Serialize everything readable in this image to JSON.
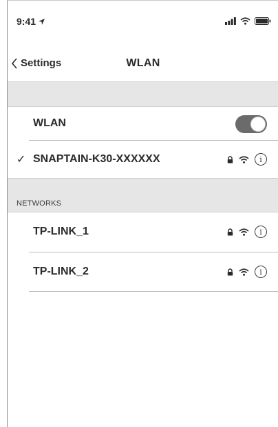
{
  "status_bar": {
    "time": "9:41",
    "icons": [
      "location-arrow-icon",
      "signal-icon",
      "wifi-icon",
      "battery-icon"
    ]
  },
  "nav": {
    "back_label": "Settings",
    "title": "WLAN"
  },
  "wlan_toggle": {
    "label": "WLAN",
    "state": "on"
  },
  "connected_network": {
    "check": "✓",
    "name": "SNAPTAIN-K30-XXXXXX",
    "secured": true
  },
  "networks_section": {
    "header": "NETWORKS",
    "items": [
      {
        "name": "TP-LINK_1",
        "secured": true
      },
      {
        "name": "TP-LINK_2",
        "secured": true
      }
    ]
  },
  "colors": {
    "toggle_on": "#6b6b6b",
    "section_bg": "#e6e6e6",
    "text": "#2b2b2b"
  }
}
